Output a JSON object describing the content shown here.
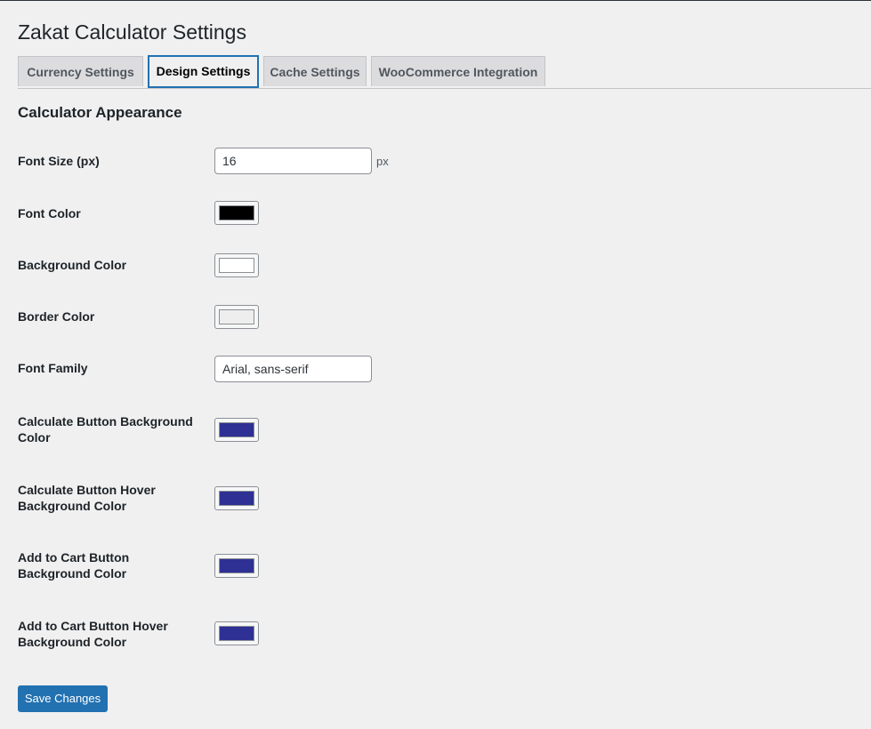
{
  "page": {
    "title": "Zakat Calculator Settings"
  },
  "tabs": [
    {
      "label": "Currency Settings",
      "active": false
    },
    {
      "label": "Design Settings",
      "active": true
    },
    {
      "label": "Cache Settings",
      "active": false
    },
    {
      "label": "WooCommerce Integration",
      "active": false
    }
  ],
  "section": {
    "title": "Calculator Appearance"
  },
  "fields": {
    "font_size": {
      "label": "Font Size (px)",
      "value": "16",
      "unit": "px"
    },
    "font_color": {
      "label": "Font Color",
      "color": "#000000"
    },
    "background_color": {
      "label": "Background Color",
      "color": "#ffffff"
    },
    "border_color": {
      "label": "Border Color",
      "color": "#eeeeee"
    },
    "font_family": {
      "label": "Font Family",
      "value": "Arial, sans-serif"
    },
    "calc_btn_bg": {
      "label": "Calculate Button Background Color",
      "color": "#2e3094"
    },
    "calc_btn_hover_bg": {
      "label": "Calculate Button Hover Background Color",
      "color": "#2e3094"
    },
    "cart_btn_bg": {
      "label": "Add to Cart Button Background Color",
      "color": "#2e3094"
    },
    "cart_btn_hover_bg": {
      "label": "Add to Cart Button Hover Background Color",
      "color": "#2e3094"
    }
  },
  "actions": {
    "save_label": "Save Changes"
  }
}
